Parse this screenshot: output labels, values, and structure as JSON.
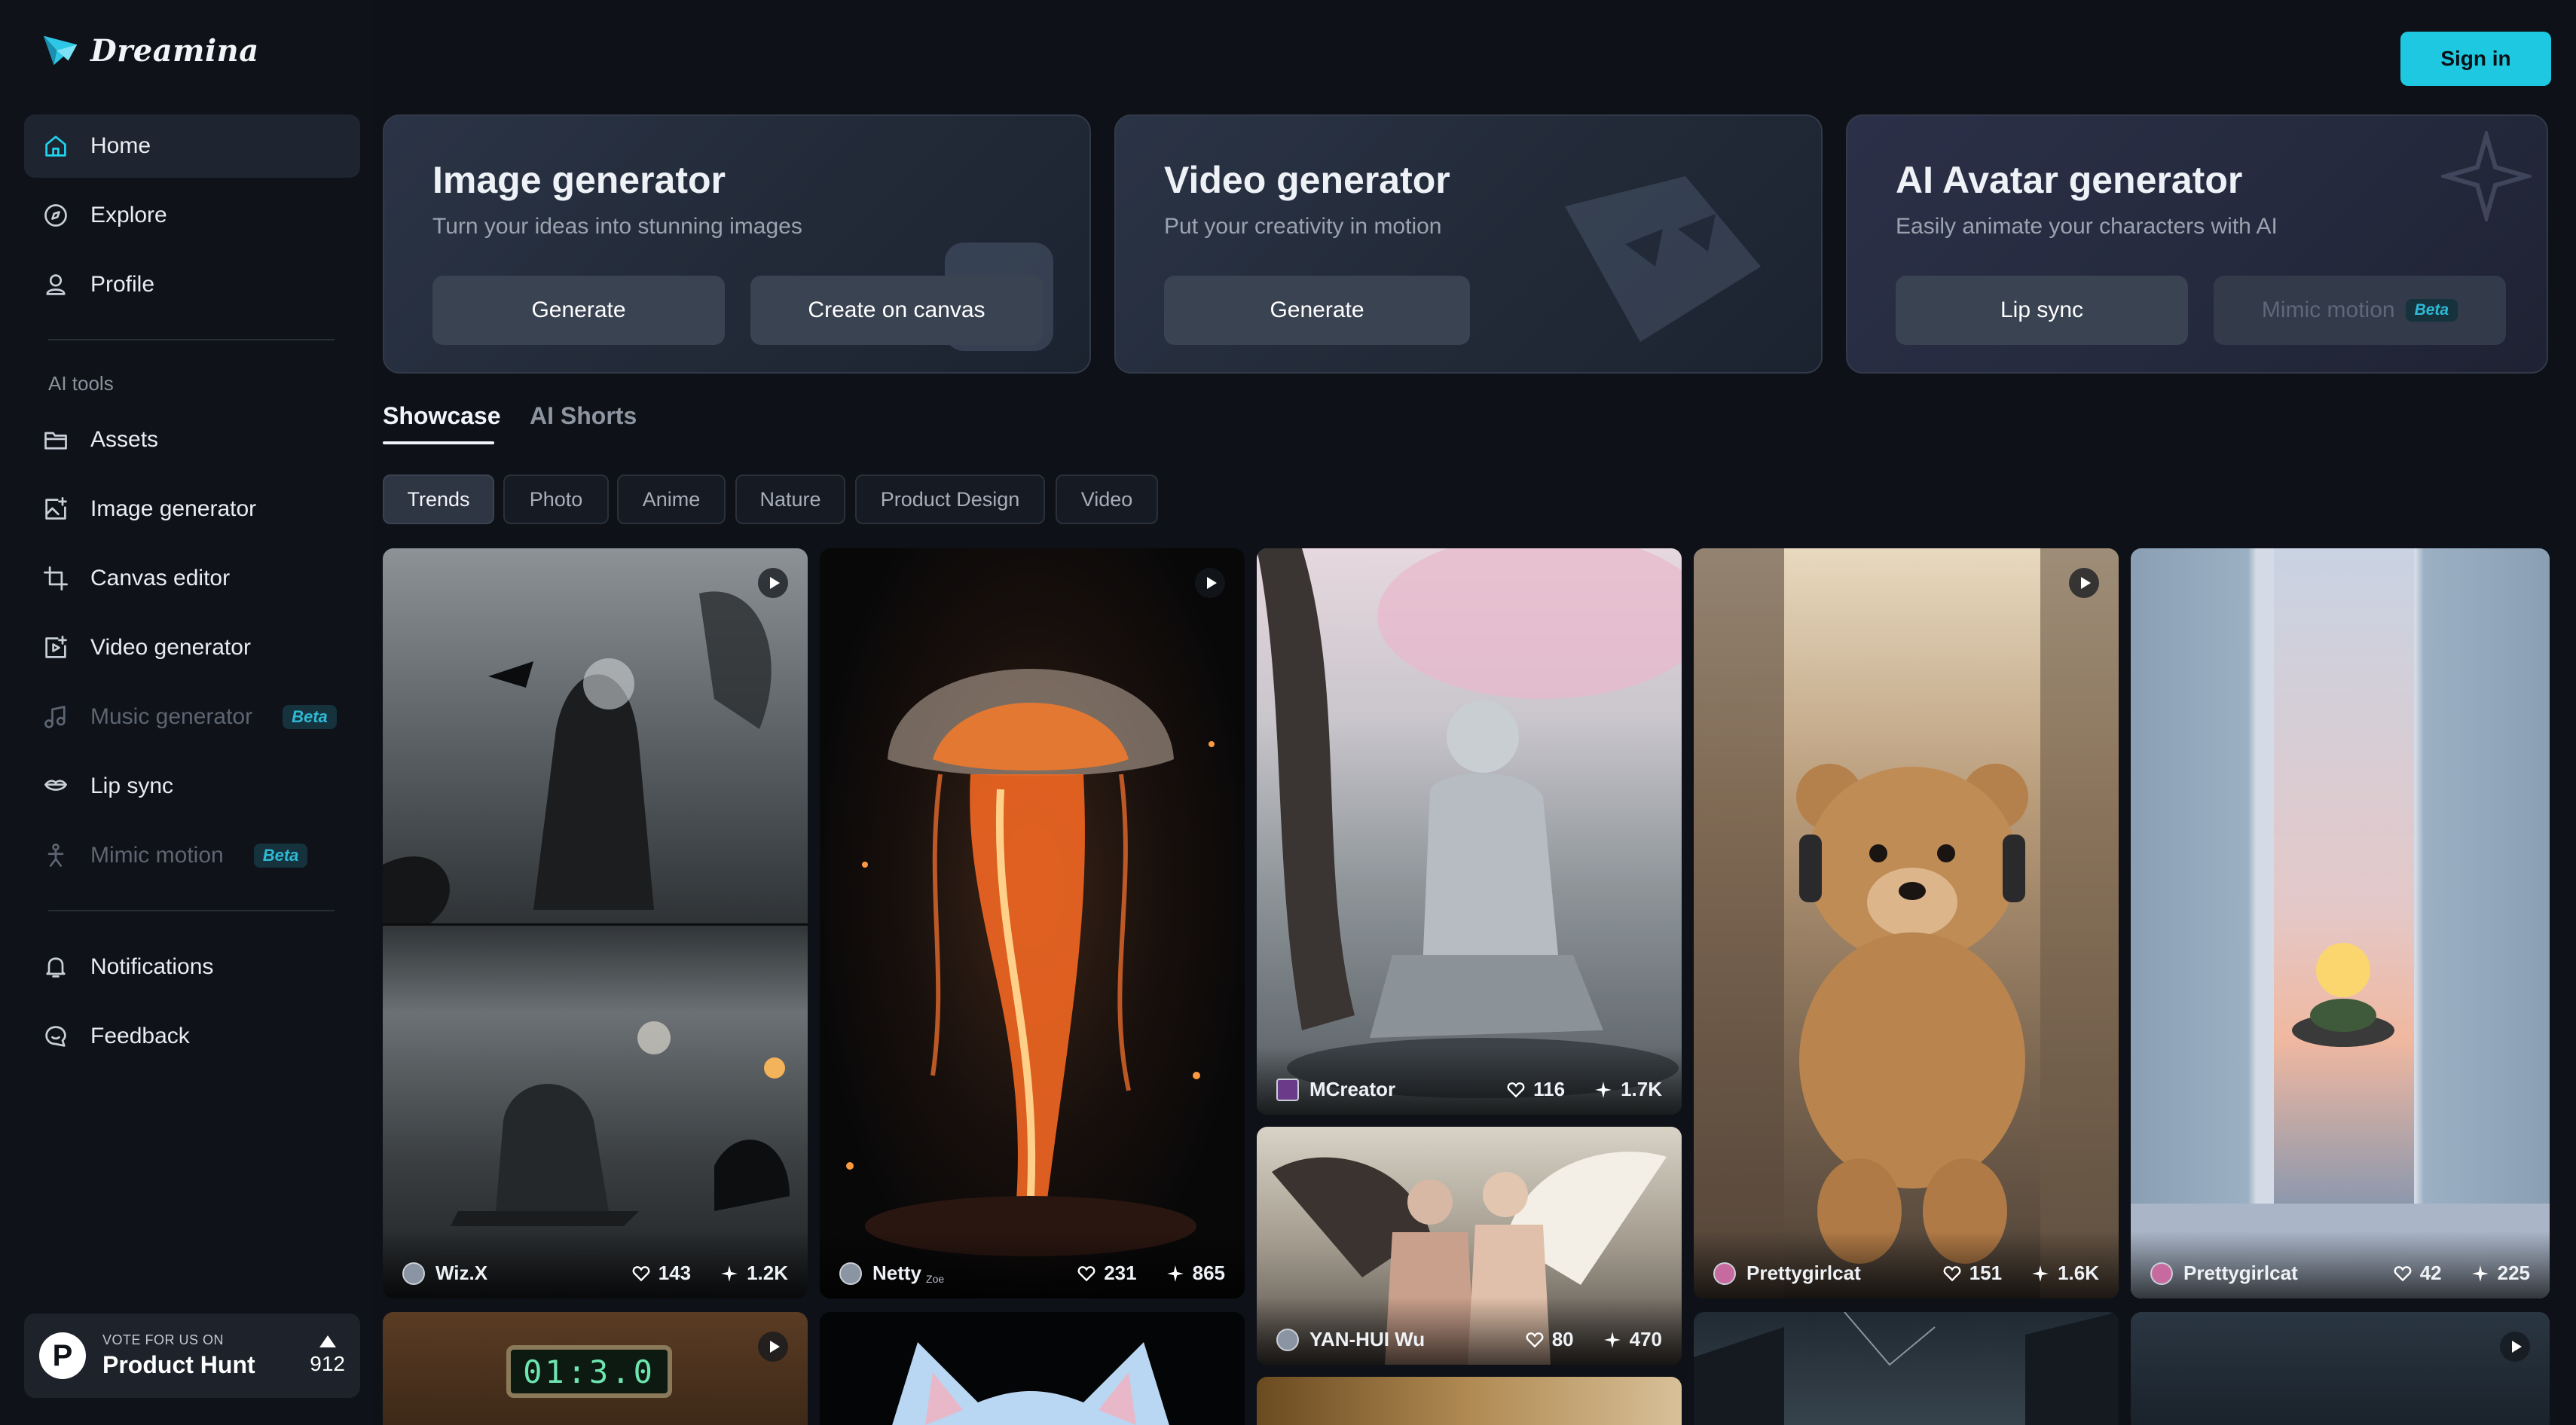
{
  "brand": {
    "name": "Dreamina"
  },
  "topbar": {
    "sign_in": "Sign in"
  },
  "sidebar": {
    "nav": [
      {
        "label": "Home",
        "icon": "home-icon"
      },
      {
        "label": "Explore",
        "icon": "compass-icon"
      },
      {
        "label": "Profile",
        "icon": "user-icon"
      }
    ],
    "section_label": "AI tools",
    "tools": [
      {
        "label": "Assets",
        "icon": "folder-icon"
      },
      {
        "label": "Image generator",
        "icon": "image-plus-icon"
      },
      {
        "label": "Canvas editor",
        "icon": "crop-icon"
      },
      {
        "label": "Video generator",
        "icon": "video-plus-icon"
      },
      {
        "label": "Music generator",
        "icon": "music-icon",
        "badge": "Beta"
      },
      {
        "label": "Lip sync",
        "icon": "lip-sync-icon"
      },
      {
        "label": "Mimic motion",
        "icon": "motion-icon",
        "badge": "Beta"
      }
    ],
    "bottom": [
      {
        "label": "Notifications",
        "icon": "bell-icon"
      },
      {
        "label": "Feedback",
        "icon": "chat-icon"
      }
    ],
    "product_hunt": {
      "small": "VOTE FOR US ON",
      "name": "Product Hunt",
      "count": "912",
      "logo_letter": "P"
    }
  },
  "generators": [
    {
      "title": "Image generator",
      "subtitle": "Turn your ideas into stunning images",
      "buttons": [
        "Generate",
        "Create on canvas"
      ]
    },
    {
      "title": "Video generator",
      "subtitle": "Put your creativity in motion",
      "buttons": [
        "Generate"
      ]
    },
    {
      "title": "AI Avatar generator",
      "subtitle": "Easily animate your characters with AI",
      "buttons": [
        "Lip sync",
        "Mimic motion"
      ],
      "badge": "Beta"
    }
  ],
  "tabs": [
    "Showcase",
    "AI Shorts"
  ],
  "chips": [
    "Trends",
    "Photo",
    "Anime",
    "Nature",
    "Product Design",
    "Video"
  ],
  "gallery": [
    {
      "user": "Wiz.X",
      "likes": "143",
      "uses": "1.2K"
    },
    {
      "user": "Netty",
      "user_suffix": "Zoe",
      "likes": "231",
      "uses": "865"
    },
    {
      "user": "MCreator",
      "likes": "116",
      "uses": "1.7K"
    },
    {
      "user": "YAN-HUI Wu",
      "likes": "80",
      "uses": "470"
    },
    {
      "user": "Prettygirlcat",
      "likes": "151",
      "uses": "1.6K"
    },
    {
      "user": "Prettygirlcat",
      "likes": "42",
      "uses": "225"
    }
  ],
  "clock_digits": "01:3.0",
  "colors": {
    "accent": "#1ec8e0",
    "background": "#0e1117",
    "sidebar_active": "#1f2530"
  }
}
